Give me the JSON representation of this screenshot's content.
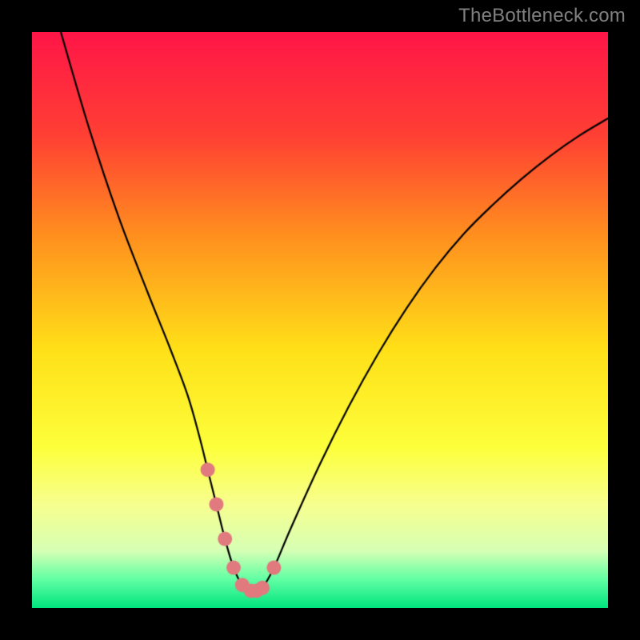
{
  "watermark": "TheBottleneck.com",
  "chart_data": {
    "type": "line",
    "title": "",
    "xlabel": "",
    "ylabel": "",
    "xlim": [
      0,
      100
    ],
    "ylim": [
      0,
      100
    ],
    "background_gradient": {
      "stops": [
        {
          "pos": 0.0,
          "color": "#ff1648"
        },
        {
          "pos": 0.18,
          "color": "#ff4034"
        },
        {
          "pos": 0.35,
          "color": "#ff8e1f"
        },
        {
          "pos": 0.55,
          "color": "#ffe018"
        },
        {
          "pos": 0.72,
          "color": "#fdff3b"
        },
        {
          "pos": 0.82,
          "color": "#f7ff8f"
        },
        {
          "pos": 0.9,
          "color": "#d7ffb5"
        },
        {
          "pos": 0.95,
          "color": "#62ffa4"
        },
        {
          "pos": 1.0,
          "color": "#00e47e"
        }
      ]
    },
    "series": [
      {
        "name": "bottleneck-curve",
        "color": "#000000",
        "width": 2.2,
        "x": [
          5,
          10,
          15,
          20,
          24,
          27,
          29,
          30.5,
          32,
          33.5,
          35,
          36.5,
          38,
          39,
          40,
          42,
          45,
          50,
          55,
          60,
          65,
          70,
          75,
          80,
          85,
          90,
          95,
          100
        ],
        "values": [
          100,
          83,
          68,
          55,
          45,
          37,
          30,
          24,
          18,
          12,
          7,
          4,
          3,
          3,
          3.5,
          7,
          14,
          25,
          35,
          44,
          52,
          59,
          65,
          70,
          74.5,
          78.5,
          82,
          85
        ]
      }
    ],
    "markers": {
      "name": "highlight-markers",
      "color": "#e17a7e",
      "radius": 9,
      "x": [
        30.5,
        32,
        33.5,
        35,
        36.5,
        38,
        39,
        40,
        42
      ],
      "values": [
        24,
        18,
        12,
        7,
        4,
        3,
        3,
        3.5,
        7
      ]
    }
  }
}
